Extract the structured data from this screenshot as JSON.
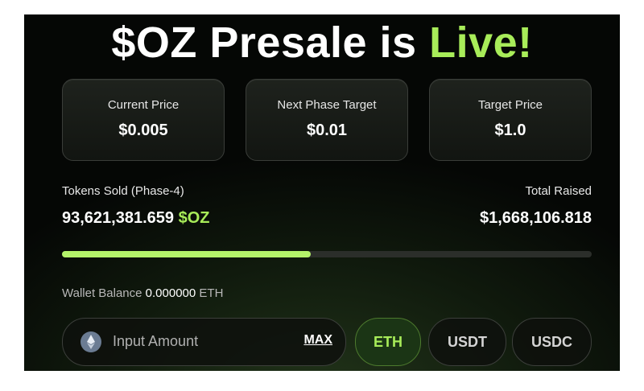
{
  "title": {
    "prefix": "$OZ Presale is ",
    "highlight": "Live!"
  },
  "cards": [
    {
      "label": "Current Price",
      "value": "$0.005"
    },
    {
      "label": "Next Phase Target",
      "value": "$0.01"
    },
    {
      "label": "Target Price",
      "value": "$1.0"
    }
  ],
  "tokens_sold": {
    "label": "Tokens Sold (Phase-4)",
    "value": "93,621,381.659",
    "unit": "$OZ"
  },
  "total_raised": {
    "label": "Total Raised",
    "value": "$1,668,106.818"
  },
  "progress": {
    "fraction": 0.47
  },
  "wallet": {
    "label": "Wallet Balance",
    "amount": "0.000000",
    "currency": "ETH"
  },
  "input": {
    "placeholder": "Input Amount",
    "max_label": "MAX"
  },
  "token_buttons": [
    {
      "label": "ETH",
      "active": true
    },
    {
      "label": "USDT",
      "active": false
    },
    {
      "label": "USDC",
      "active": false
    }
  ],
  "colors": {
    "accent": "#a8ec59",
    "background": "#050505"
  }
}
